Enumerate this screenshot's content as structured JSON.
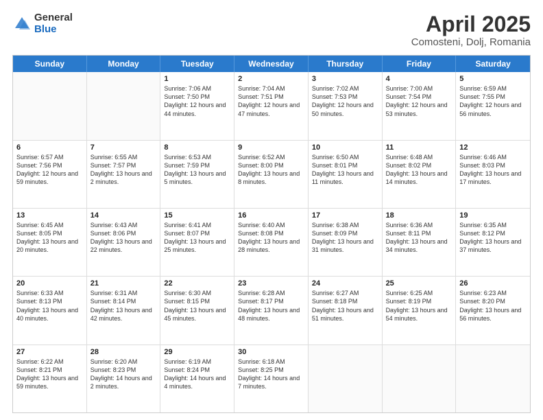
{
  "header": {
    "logo_general": "General",
    "logo_blue": "Blue",
    "main_title": "April 2025",
    "subtitle": "Comosteni, Dolj, Romania"
  },
  "calendar": {
    "days": [
      "Sunday",
      "Monday",
      "Tuesday",
      "Wednesday",
      "Thursday",
      "Friday",
      "Saturday"
    ],
    "rows": [
      [
        {
          "day": "",
          "empty": true
        },
        {
          "day": "",
          "empty": true
        },
        {
          "day": "1",
          "sunrise": "Sunrise: 7:06 AM",
          "sunset": "Sunset: 7:50 PM",
          "daylight": "Daylight: 12 hours and 44 minutes."
        },
        {
          "day": "2",
          "sunrise": "Sunrise: 7:04 AM",
          "sunset": "Sunset: 7:51 PM",
          "daylight": "Daylight: 12 hours and 47 minutes."
        },
        {
          "day": "3",
          "sunrise": "Sunrise: 7:02 AM",
          "sunset": "Sunset: 7:53 PM",
          "daylight": "Daylight: 12 hours and 50 minutes."
        },
        {
          "day": "4",
          "sunrise": "Sunrise: 7:00 AM",
          "sunset": "Sunset: 7:54 PM",
          "daylight": "Daylight: 12 hours and 53 minutes."
        },
        {
          "day": "5",
          "sunrise": "Sunrise: 6:59 AM",
          "sunset": "Sunset: 7:55 PM",
          "daylight": "Daylight: 12 hours and 56 minutes."
        }
      ],
      [
        {
          "day": "6",
          "sunrise": "Sunrise: 6:57 AM",
          "sunset": "Sunset: 7:56 PM",
          "daylight": "Daylight: 12 hours and 59 minutes."
        },
        {
          "day": "7",
          "sunrise": "Sunrise: 6:55 AM",
          "sunset": "Sunset: 7:57 PM",
          "daylight": "Daylight: 13 hours and 2 minutes."
        },
        {
          "day": "8",
          "sunrise": "Sunrise: 6:53 AM",
          "sunset": "Sunset: 7:59 PM",
          "daylight": "Daylight: 13 hours and 5 minutes."
        },
        {
          "day": "9",
          "sunrise": "Sunrise: 6:52 AM",
          "sunset": "Sunset: 8:00 PM",
          "daylight": "Daylight: 13 hours and 8 minutes."
        },
        {
          "day": "10",
          "sunrise": "Sunrise: 6:50 AM",
          "sunset": "Sunset: 8:01 PM",
          "daylight": "Daylight: 13 hours and 11 minutes."
        },
        {
          "day": "11",
          "sunrise": "Sunrise: 6:48 AM",
          "sunset": "Sunset: 8:02 PM",
          "daylight": "Daylight: 13 hours and 14 minutes."
        },
        {
          "day": "12",
          "sunrise": "Sunrise: 6:46 AM",
          "sunset": "Sunset: 8:03 PM",
          "daylight": "Daylight: 13 hours and 17 minutes."
        }
      ],
      [
        {
          "day": "13",
          "sunrise": "Sunrise: 6:45 AM",
          "sunset": "Sunset: 8:05 PM",
          "daylight": "Daylight: 13 hours and 20 minutes."
        },
        {
          "day": "14",
          "sunrise": "Sunrise: 6:43 AM",
          "sunset": "Sunset: 8:06 PM",
          "daylight": "Daylight: 13 hours and 22 minutes."
        },
        {
          "day": "15",
          "sunrise": "Sunrise: 6:41 AM",
          "sunset": "Sunset: 8:07 PM",
          "daylight": "Daylight: 13 hours and 25 minutes."
        },
        {
          "day": "16",
          "sunrise": "Sunrise: 6:40 AM",
          "sunset": "Sunset: 8:08 PM",
          "daylight": "Daylight: 13 hours and 28 minutes."
        },
        {
          "day": "17",
          "sunrise": "Sunrise: 6:38 AM",
          "sunset": "Sunset: 8:09 PM",
          "daylight": "Daylight: 13 hours and 31 minutes."
        },
        {
          "day": "18",
          "sunrise": "Sunrise: 6:36 AM",
          "sunset": "Sunset: 8:11 PM",
          "daylight": "Daylight: 13 hours and 34 minutes."
        },
        {
          "day": "19",
          "sunrise": "Sunrise: 6:35 AM",
          "sunset": "Sunset: 8:12 PM",
          "daylight": "Daylight: 13 hours and 37 minutes."
        }
      ],
      [
        {
          "day": "20",
          "sunrise": "Sunrise: 6:33 AM",
          "sunset": "Sunset: 8:13 PM",
          "daylight": "Daylight: 13 hours and 40 minutes."
        },
        {
          "day": "21",
          "sunrise": "Sunrise: 6:31 AM",
          "sunset": "Sunset: 8:14 PM",
          "daylight": "Daylight: 13 hours and 42 minutes."
        },
        {
          "day": "22",
          "sunrise": "Sunrise: 6:30 AM",
          "sunset": "Sunset: 8:15 PM",
          "daylight": "Daylight: 13 hours and 45 minutes."
        },
        {
          "day": "23",
          "sunrise": "Sunrise: 6:28 AM",
          "sunset": "Sunset: 8:17 PM",
          "daylight": "Daylight: 13 hours and 48 minutes."
        },
        {
          "day": "24",
          "sunrise": "Sunrise: 6:27 AM",
          "sunset": "Sunset: 8:18 PM",
          "daylight": "Daylight: 13 hours and 51 minutes."
        },
        {
          "day": "25",
          "sunrise": "Sunrise: 6:25 AM",
          "sunset": "Sunset: 8:19 PM",
          "daylight": "Daylight: 13 hours and 54 minutes."
        },
        {
          "day": "26",
          "sunrise": "Sunrise: 6:23 AM",
          "sunset": "Sunset: 8:20 PM",
          "daylight": "Daylight: 13 hours and 56 minutes."
        }
      ],
      [
        {
          "day": "27",
          "sunrise": "Sunrise: 6:22 AM",
          "sunset": "Sunset: 8:21 PM",
          "daylight": "Daylight: 13 hours and 59 minutes."
        },
        {
          "day": "28",
          "sunrise": "Sunrise: 6:20 AM",
          "sunset": "Sunset: 8:23 PM",
          "daylight": "Daylight: 14 hours and 2 minutes."
        },
        {
          "day": "29",
          "sunrise": "Sunrise: 6:19 AM",
          "sunset": "Sunset: 8:24 PM",
          "daylight": "Daylight: 14 hours and 4 minutes."
        },
        {
          "day": "30",
          "sunrise": "Sunrise: 6:18 AM",
          "sunset": "Sunset: 8:25 PM",
          "daylight": "Daylight: 14 hours and 7 minutes."
        },
        {
          "day": "",
          "empty": true
        },
        {
          "day": "",
          "empty": true
        },
        {
          "day": "",
          "empty": true
        }
      ]
    ]
  }
}
